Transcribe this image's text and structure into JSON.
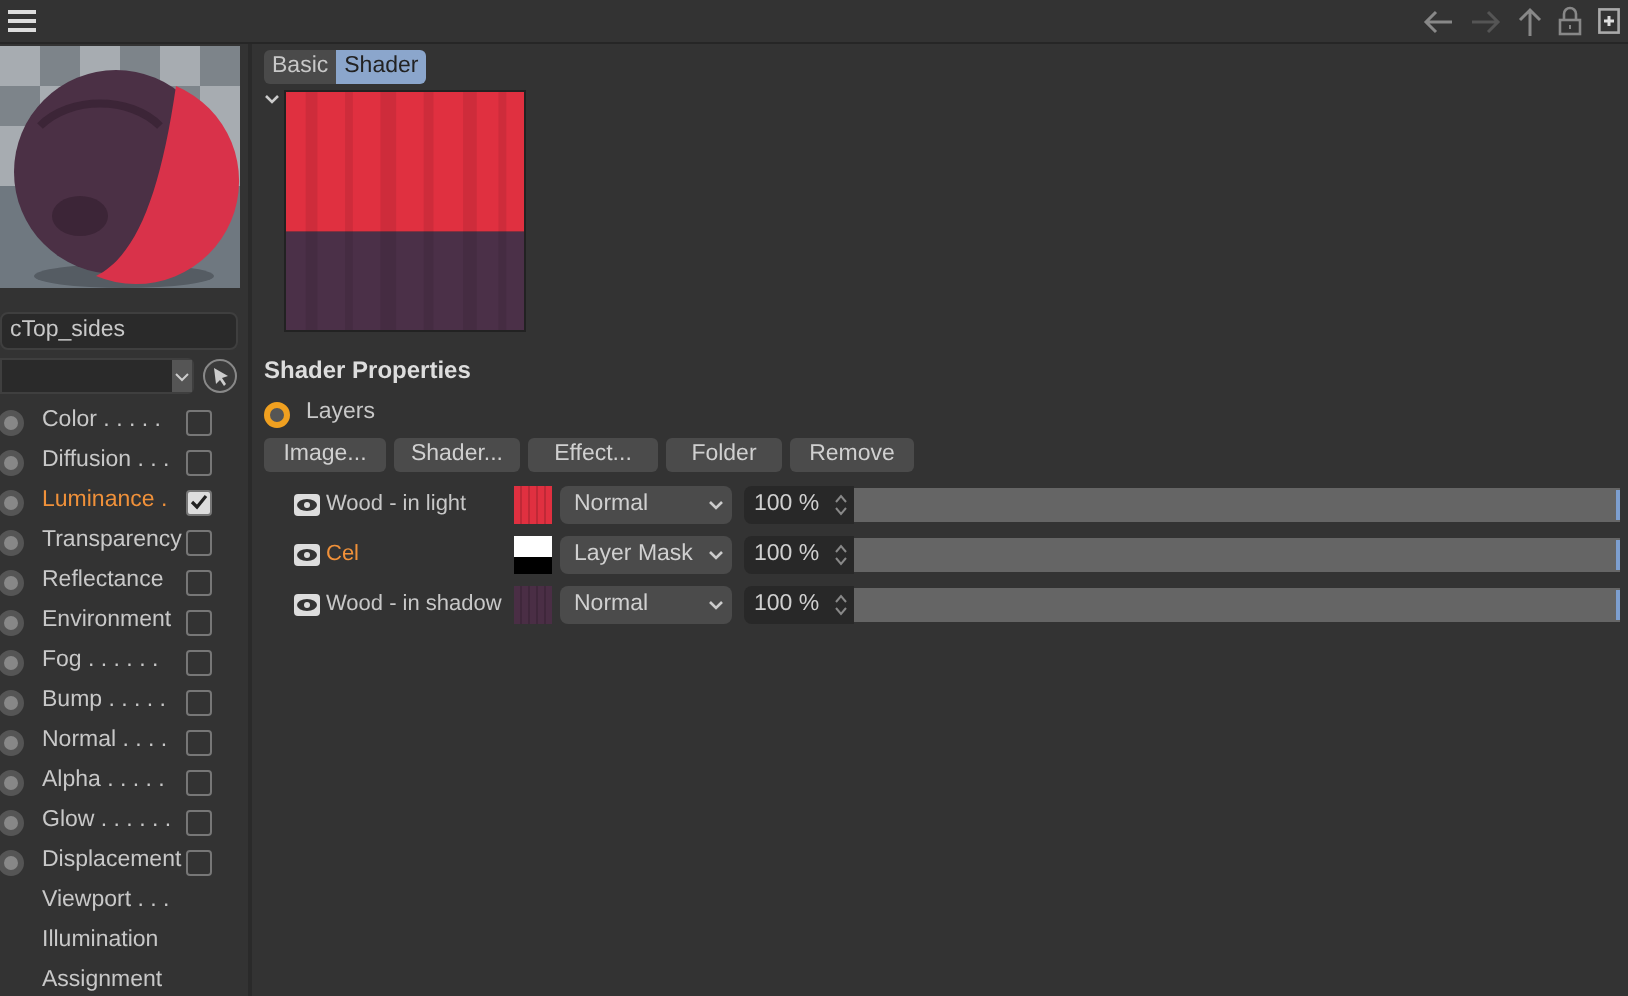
{
  "material": {
    "name": "cTop_sides"
  },
  "channels": [
    {
      "kind": "channel",
      "label": "Color",
      "leader": ". . . . .",
      "selected": false,
      "checked": false
    },
    {
      "kind": "channel",
      "label": "Diffusion",
      "leader": ". . .",
      "selected": false,
      "checked": false
    },
    {
      "kind": "channel",
      "label": "Luminance",
      "leader": ".",
      "selected": true,
      "checked": true
    },
    {
      "kind": "channel",
      "label": "Transparency",
      "selected": false,
      "checked": false
    },
    {
      "kind": "channel",
      "label": "Reflectance",
      "selected": false,
      "checked": false
    },
    {
      "kind": "channel",
      "label": "Environment",
      "selected": false,
      "checked": false
    },
    {
      "kind": "channel",
      "label": "Fog",
      "leader": ". . . . . .",
      "selected": false,
      "checked": false
    },
    {
      "kind": "channel",
      "label": "Bump",
      "leader": ". . . . .",
      "selected": false,
      "checked": false
    },
    {
      "kind": "channel",
      "label": "Normal",
      "leader": ". . . .",
      "selected": false,
      "checked": false
    },
    {
      "kind": "channel",
      "label": "Alpha",
      "leader": ". . . . .",
      "selected": false,
      "checked": false
    },
    {
      "kind": "channel",
      "label": "Glow",
      "leader": ". . . . . .",
      "selected": false,
      "checked": false
    },
    {
      "kind": "channel",
      "label": "Displacement",
      "selected": false,
      "checked": false
    },
    {
      "kind": "page",
      "label": "Viewport",
      "leader": ". . ."
    },
    {
      "kind": "page",
      "label": "Illumination"
    },
    {
      "kind": "page",
      "label": "Assignment"
    }
  ],
  "tabs": [
    {
      "label": "Basic",
      "selected": false
    },
    {
      "label": "Shader",
      "selected": true
    }
  ],
  "shader_properties": {
    "title": "Shader Properties",
    "mode": {
      "label": "Layers",
      "selected": true
    },
    "buttons": [
      "Image...",
      "Shader...",
      "Effect...",
      "Folder",
      "Remove"
    ],
    "layers": [
      {
        "name": "Wood - in light",
        "selected": false,
        "kind": "texture",
        "color": "#e03040",
        "blend": "Normal",
        "opacity": "100 %",
        "level": 1
      },
      {
        "name": "Cel",
        "selected": true,
        "kind": "mask",
        "color": "#ffffff",
        "blend": "Layer Mask",
        "opacity": "100 %",
        "level": 1
      },
      {
        "name": "Wood - in shadow",
        "selected": false,
        "kind": "texture",
        "color": "#4a2e45",
        "blend": "Normal",
        "opacity": "100 %",
        "level": 1
      }
    ]
  }
}
